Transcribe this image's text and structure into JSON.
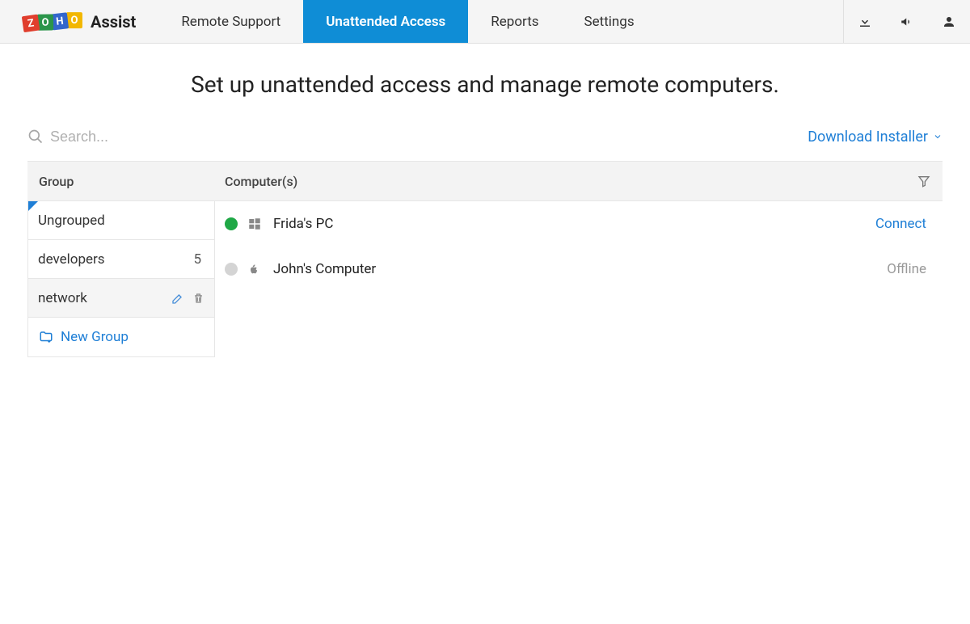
{
  "brand": {
    "product": "Assist"
  },
  "nav": {
    "remote_support": "Remote Support",
    "unattended_access": "Unattended Access",
    "reports": "Reports",
    "settings": "Settings"
  },
  "page": {
    "title": "Set up unattended access and manage remote computers."
  },
  "toolbar": {
    "search_placeholder": "Search...",
    "download_installer": "Download Installer"
  },
  "table": {
    "group_header": "Group",
    "computers_header": "Computer(s)"
  },
  "groups": [
    {
      "name": "Ungrouped",
      "selected": true
    },
    {
      "name": "developers",
      "count": "5"
    },
    {
      "name": "network",
      "editing": true
    }
  ],
  "new_group_label": "New Group",
  "computers": [
    {
      "name": "Frida's PC",
      "os": "windows",
      "status": "online",
      "action": "Connect"
    },
    {
      "name": "John's Computer",
      "os": "apple",
      "status": "offline",
      "action": "Offline"
    }
  ]
}
